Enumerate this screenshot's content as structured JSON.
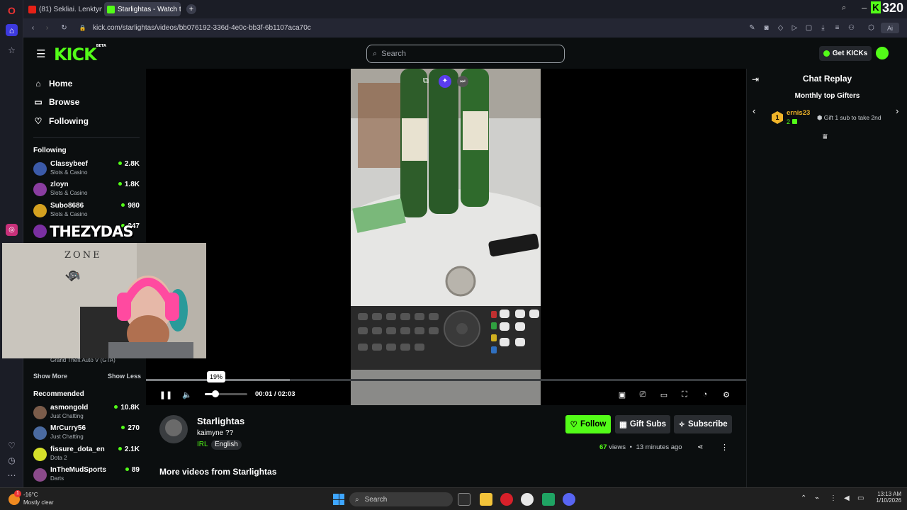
{
  "browser": {
    "tabs": [
      {
        "label": "(81) Sekliai. Lenktynės su ..."
      },
      {
        "label": "Starlightas - Watch the V..."
      }
    ],
    "url": "kick.com/starlightas/videos/bb076192-336d-4e0c-bb3f-6b1107aca70c",
    "corner_badge": "320"
  },
  "header": {
    "logo": "KICK",
    "logo_sup": "BETA",
    "search_placeholder": "Search",
    "get_kicks": "Get KICKs"
  },
  "sidebar": {
    "nav": [
      {
        "label": "Home",
        "icon": "home-icon"
      },
      {
        "label": "Browse",
        "icon": "browse-icon"
      },
      {
        "label": "Following",
        "icon": "heart-icon"
      }
    ],
    "following_title": "Following",
    "following": [
      {
        "name": "Classybeef",
        "category": "Slots & Casino",
        "viewers": "2.8K",
        "color": "#3b5aa8"
      },
      {
        "name": "zloyn",
        "category": "Slots & Casino",
        "viewers": "1.8K",
        "color": "#8a3da0"
      },
      {
        "name": "Subo8686",
        "category": "Slots & Casino",
        "viewers": "980",
        "color": "#d4a120"
      },
      {
        "name": "",
        "category": "",
        "viewers": "347",
        "color": "#7a2fa1"
      }
    ],
    "hidden_game": "Grand Theft Auto V (GTA)",
    "show_more": "Show More",
    "show_less": "Show Less",
    "recommended_title": "Recommended",
    "recommended": [
      {
        "name": "asmongold",
        "category": "Just Chatting",
        "viewers": "10.8K",
        "color": "#7b5c4a"
      },
      {
        "name": "MrCurry56",
        "category": "Just Chatting",
        "viewers": "270",
        "color": "#4a6aa0"
      },
      {
        "name": "fissure_dota_en",
        "category": "Dota 2",
        "viewers": "2.1K",
        "color": "#d6e02a"
      },
      {
        "name": "InTheMudSports",
        "category": "Darts",
        "viewers": "89",
        "color": "#8a4a8a"
      }
    ]
  },
  "webcam": {
    "overlay_text": "THEZYDAS",
    "wall_text": "ZONE"
  },
  "player": {
    "volume_tooltip": "19%",
    "time_current": "00:01",
    "time_separator": "/",
    "time_total": "02:03",
    "progress": 0.24,
    "buffered": 0.24
  },
  "chat": {
    "title": "Chat Replay",
    "gifters_title": "Monthly top Gifters",
    "top_gifter": {
      "rank": "1",
      "name": "ernis23",
      "count": "2"
    },
    "gift_prompt": "Gift 1 sub to take 2nd"
  },
  "stream": {
    "channel": "Starlightas",
    "title": "kaimyne ??",
    "category": "IRL",
    "language": "English",
    "follow": "Follow",
    "gift_subs": "Gift Subs",
    "subscribe": "Subscribe",
    "views": "67",
    "views_label": "views",
    "ago": "13 minutes ago",
    "more_videos": "More videos from Starlightas"
  },
  "taskbar": {
    "weather_temp": "-16°C",
    "weather_desc": "Mostly clear",
    "search": "Search",
    "notification_count": "1",
    "time": "13:13 AM",
    "date": "1/10/2026"
  },
  "colors": {
    "brand": "#53fc18",
    "bg": "#0b0e0f"
  }
}
